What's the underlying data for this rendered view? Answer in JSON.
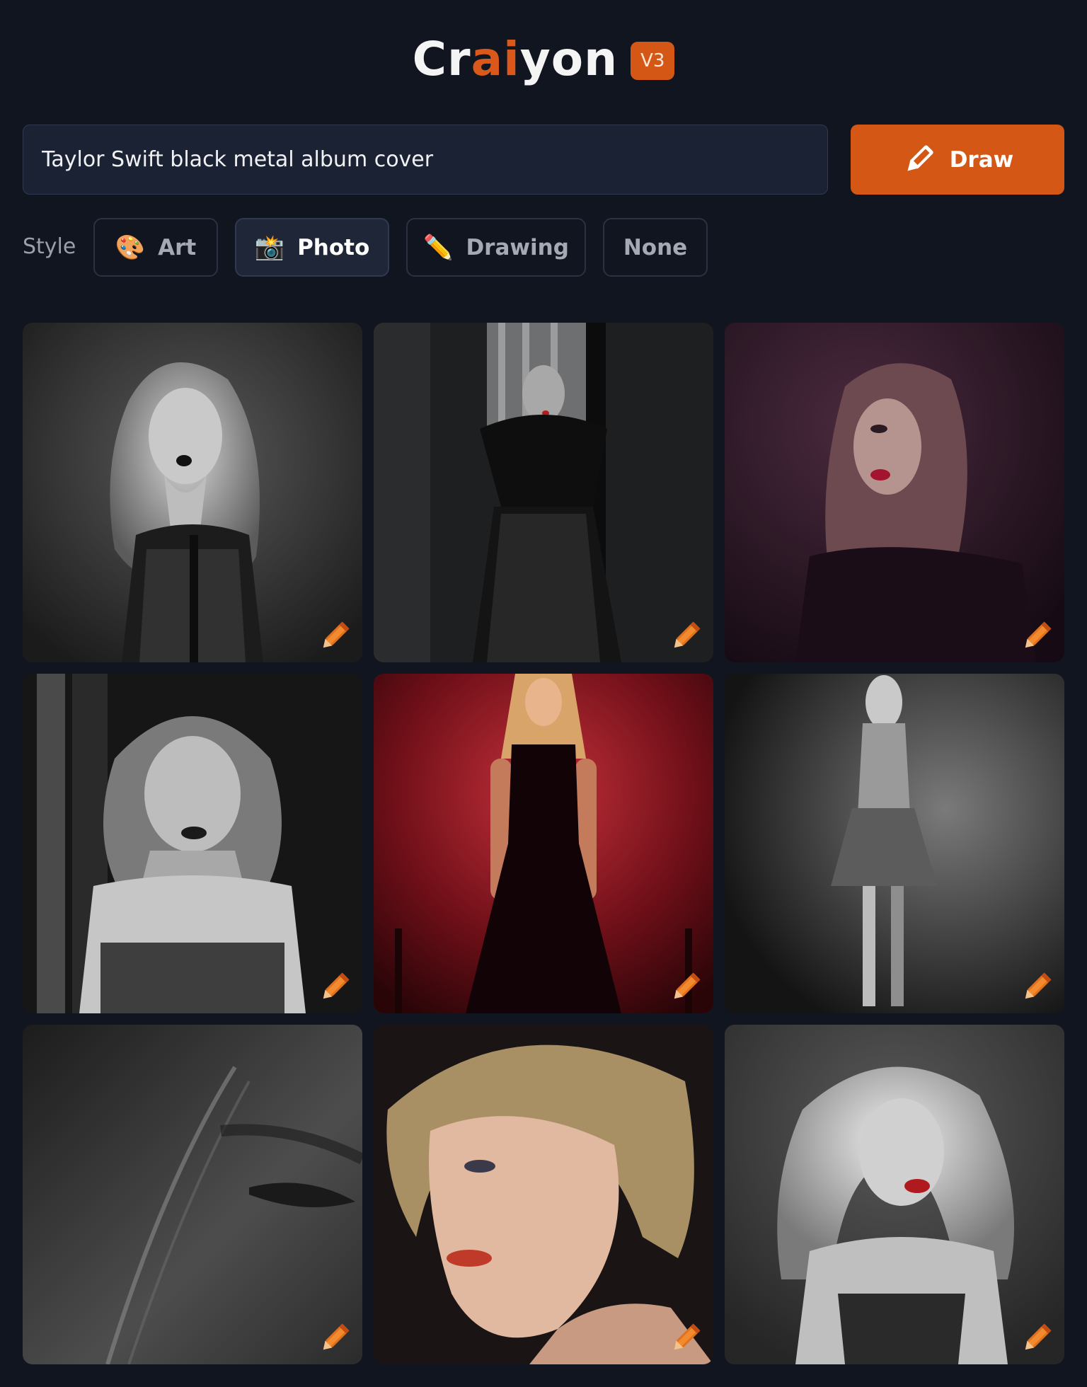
{
  "app": {
    "logo_parts": [
      "Cr",
      "ai",
      "yon"
    ],
    "version": "V3",
    "accent_color": "#d45716",
    "background_color": "#11151f"
  },
  "prompt": {
    "value": "Taylor Swift black metal album cover",
    "draw_label": "Draw",
    "draw_icon": "pencil-icon"
  },
  "style": {
    "label": "Style",
    "options": [
      {
        "label": "Art",
        "icon": "🎨",
        "icon_name": "palette-icon",
        "selected": false
      },
      {
        "label": "Photo",
        "icon": "📸",
        "icon_name": "camera-flash-icon",
        "selected": true
      },
      {
        "label": "Drawing",
        "icon": "✏️",
        "icon_name": "pencil-icon",
        "selected": false
      },
      {
        "label": "None",
        "icon": "",
        "icon_name": "",
        "selected": false
      }
    ]
  },
  "results": {
    "count": 9,
    "edit_icon": "pencil-edit-icon"
  }
}
